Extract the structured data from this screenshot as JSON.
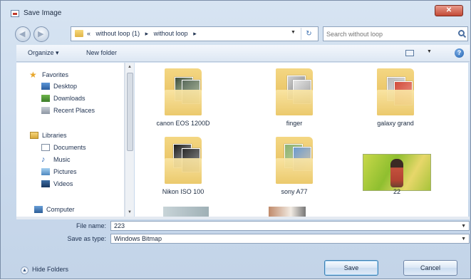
{
  "window": {
    "title": "Save Image"
  },
  "address": {
    "crumbs": [
      "«",
      "without loop (1)",
      "▸",
      "without loop",
      "▸"
    ]
  },
  "search": {
    "placeholder": "Search without loop"
  },
  "toolbar": {
    "organize": "Organize ▾",
    "new_folder": "New folder"
  },
  "sidebar": {
    "items": [
      {
        "label": "Favorites",
        "icon": "star-icon"
      },
      {
        "label": "Desktop",
        "icon": "desktop-icon"
      },
      {
        "label": "Downloads",
        "icon": "downloads-icon"
      },
      {
        "label": "Recent Places",
        "icon": "recent-places-icon"
      },
      {
        "label": "Libraries",
        "icon": "libraries-icon"
      },
      {
        "label": "Documents",
        "icon": "documents-icon"
      },
      {
        "label": "Music",
        "icon": "music-icon"
      },
      {
        "label": "Pictures",
        "icon": "pictures-icon"
      },
      {
        "label": "Videos",
        "icon": "videos-icon"
      },
      {
        "label": "Computer",
        "icon": "computer-icon"
      }
    ]
  },
  "files": [
    {
      "name": "canon EOS 1200D",
      "type": "folder"
    },
    {
      "name": "finger",
      "type": "folder"
    },
    {
      "name": "galaxy grand",
      "type": "folder"
    },
    {
      "name": "Nikon ISO 100",
      "type": "folder"
    },
    {
      "name": "sony A77",
      "type": "folder"
    },
    {
      "name": "22",
      "type": "image"
    }
  ],
  "form": {
    "filename_label": "File name:",
    "filename_value": "223",
    "type_label": "Save as type:",
    "type_value": "Windows Bitmap"
  },
  "footer": {
    "hide_folders": "Hide Folders",
    "save": "Save",
    "cancel": "Cancel"
  },
  "colors": {
    "accent": "#3c7fb1",
    "folder": "#e2b64f",
    "close": "#c24a36"
  }
}
